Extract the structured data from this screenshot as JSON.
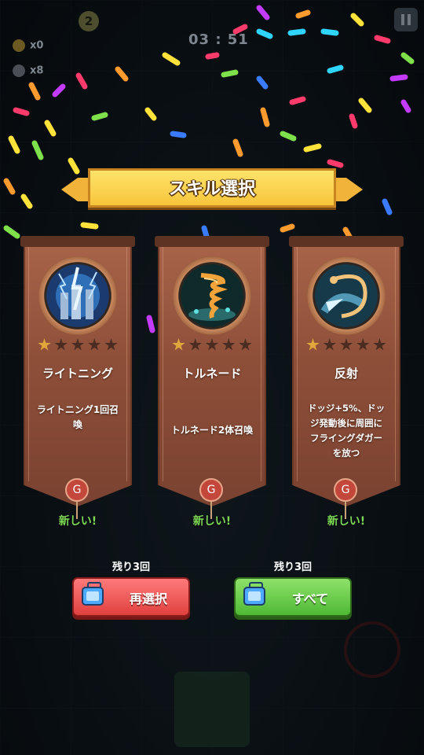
{
  "hud": {
    "level": "2",
    "timer": "03 : 51",
    "coins": "x0",
    "kills": "x8"
  },
  "title": "スキル選択",
  "cards": [
    {
      "name": "ライトニング",
      "desc": "ライトニング1回召\n喚",
      "new_label": "新しい!",
      "stars_filled": 1,
      "stars_total": 5
    },
    {
      "name": "トルネード",
      "desc": "トルネード2体召喚",
      "new_label": "新しい!",
      "stars_filled": 1,
      "stars_total": 5
    },
    {
      "name": "反射",
      "desc": "ドッジ+5%、ドッ\nジ発動後に周囲に\nフライングダガー\nを放つ",
      "new_label": "新しい!",
      "stars_filled": 1,
      "stars_total": 5
    }
  ],
  "reroll": {
    "remaining": "残り3回",
    "label": "再選択"
  },
  "all": {
    "remaining": "残り3回",
    "label": "すべて"
  },
  "colors": {
    "banner": "#f7c53b",
    "card": "#8e4f39",
    "new_text": "#7ed957",
    "reroll_button": "#e0413f",
    "all_button": "#4fb935",
    "star_filled": "#e0a83a",
    "star_empty": "#4a2c20"
  },
  "icons": {
    "card1": "lightning-skill-icon",
    "card2": "tornado-skill-icon",
    "card3": "dragon-reflect-skill-icon",
    "ad": "tv-ad-icon"
  }
}
